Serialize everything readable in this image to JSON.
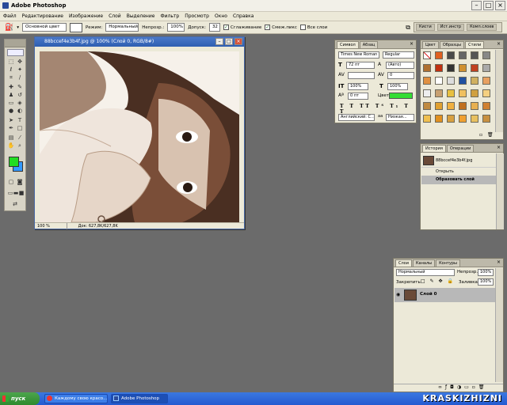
{
  "app": {
    "title": "Adobe Photoshop"
  },
  "menu": [
    "Файл",
    "Редактирование",
    "Изображение",
    "Слой",
    "Выделение",
    "Фильтр",
    "Просмотр",
    "Окно",
    "Справка"
  ],
  "options": {
    "source": "Основной цвет",
    "mode_label": "Режим:",
    "mode_value": "Нормальный",
    "opacity_label": "Непрозр.:",
    "opacity_value": "100%",
    "tolerance_label": "Допуск:",
    "tolerance_value": "32",
    "antialias_label": "Сглаживание",
    "contiguous_label": "Смеж.пикс",
    "all_layers_label": "Все слои",
    "well_tabs": [
      "Кисти",
      "Ист.инстр",
      "Комп.слоев"
    ]
  },
  "document": {
    "title": "88bccef4e3b4f.jpg @ 100% (Слой 0, RGB/8#)",
    "zoom": "100 %",
    "doc_info": "Док: 627,8K/627,8K"
  },
  "character_panel": {
    "tabs": [
      "Символ",
      "Абзац"
    ],
    "font_family": "Times New Roman",
    "font_style": "Regular",
    "font_size": "72 пт",
    "leading": "(Авто)",
    "kerning": "",
    "tracking": "0",
    "vscale": "100%",
    "hscale": "100%",
    "baseline": "0 пт",
    "color_label": "Цвет:",
    "language": "Английский: С...",
    "aa": "Низкая...",
    "text_color": "#33dd33"
  },
  "styles_panel": {
    "tabs": [
      "Цвет",
      "Образцы",
      "Стили"
    ]
  },
  "history_panel": {
    "tabs": [
      "История",
      "Операции"
    ],
    "snapshot": "88bccef4e3b4f.jpg",
    "items": [
      "Открыть",
      "Образовать слой"
    ]
  },
  "layers_panel": {
    "tabs": [
      "Слои",
      "Каналы",
      "Контуры"
    ],
    "blend": "Нормальный",
    "opacity_label": "Непрозр.:",
    "opacity_value": "100%",
    "lock_label": "Закрепить:",
    "fill_label": "Заливка:",
    "fill_value": "100%",
    "layer_name": "Слой 0"
  },
  "colors": {
    "foreground": "#22dd22",
    "background": "#3399ff"
  },
  "taskbar": {
    "start": "пуск",
    "items": [
      "Каждому свою красо...",
      "Adobe Photoshop"
    ]
  },
  "watermark": "KRASKIZHIZNI"
}
